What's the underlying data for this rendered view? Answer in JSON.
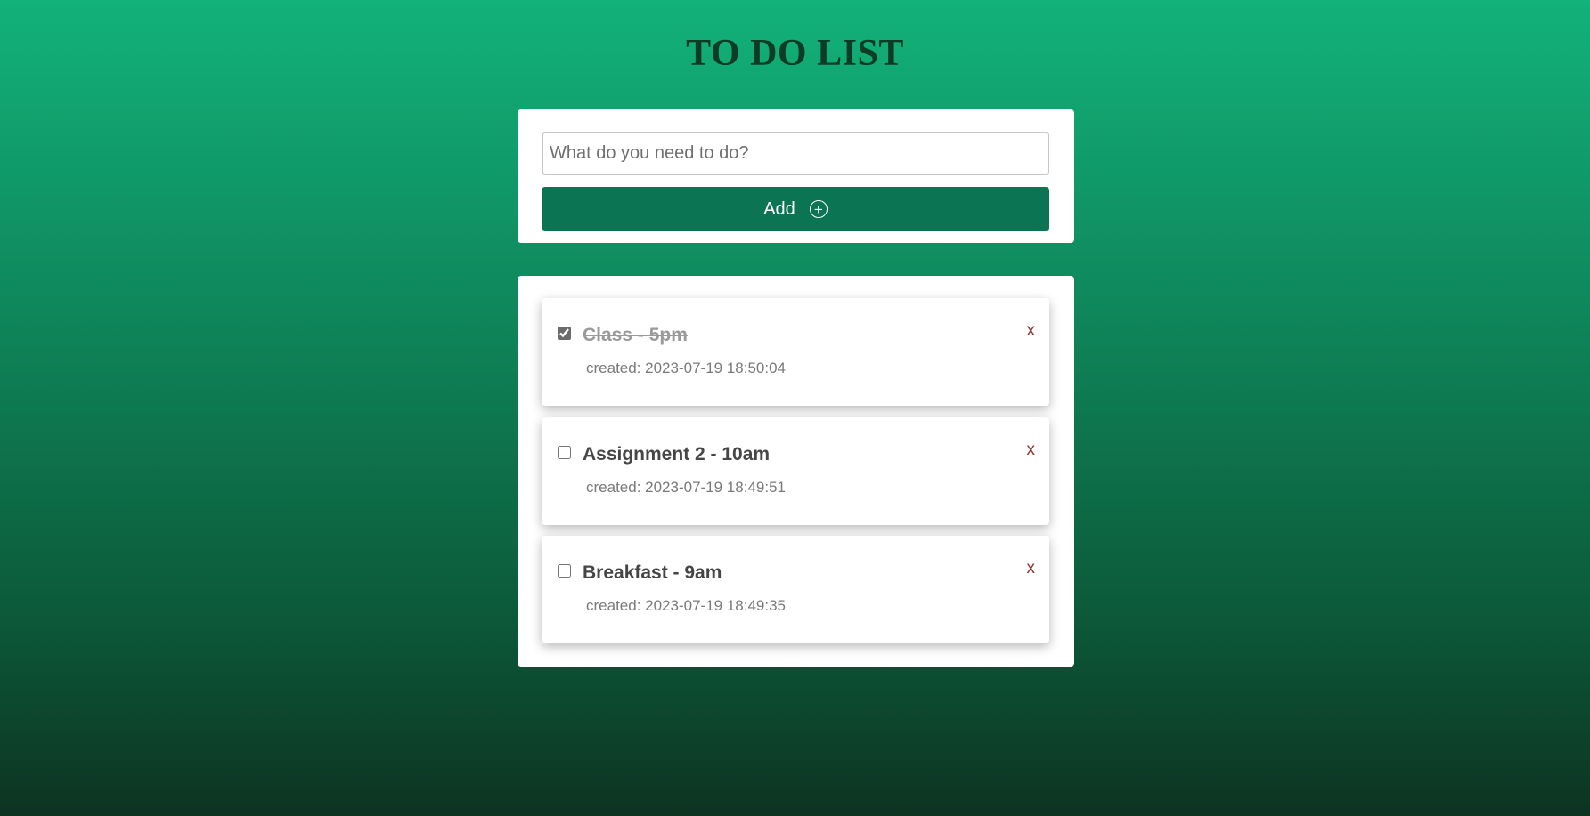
{
  "header": {
    "title": "TO DO LIST"
  },
  "add_form": {
    "input_value": "",
    "input_placeholder": "What do you need to do?",
    "add_label": "Add",
    "add_icon": "plus-circle-icon"
  },
  "todos": [
    {
      "title": "Class - 5pm",
      "created": "created: 2023-07-19 18:50:04",
      "checked": true,
      "delete_label": "x"
    },
    {
      "title": "Assignment 2 - 10am",
      "created": "created: 2023-07-19 18:49:51",
      "checked": false,
      "delete_label": "x"
    },
    {
      "title": "Breakfast - 9am",
      "created": "created: 2023-07-19 18:49:35",
      "checked": false,
      "delete_label": "x"
    }
  ],
  "colors": {
    "accent": "#0b7452",
    "title": "#0d3b25",
    "delete": "#8b3a33"
  }
}
